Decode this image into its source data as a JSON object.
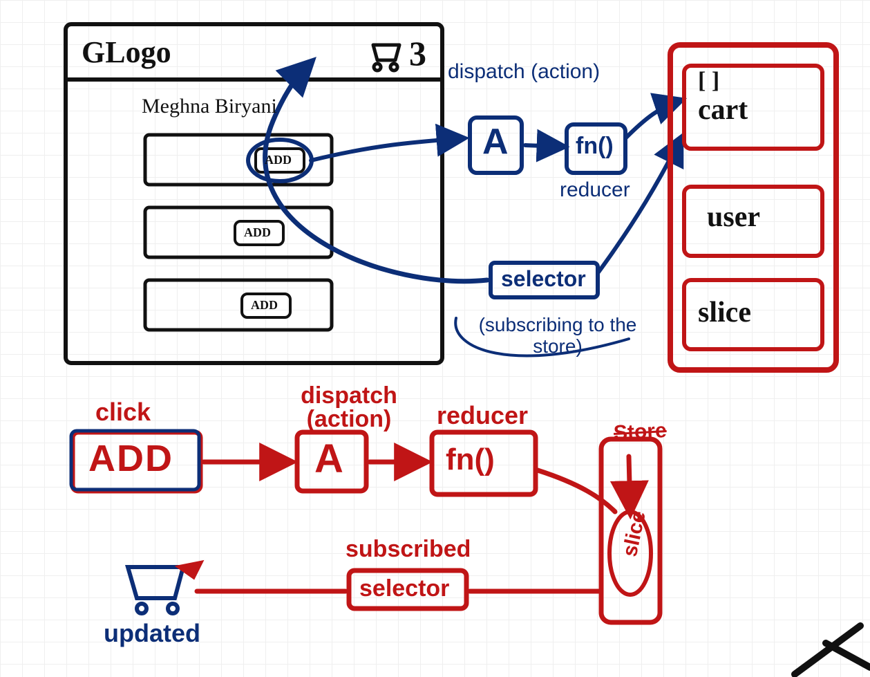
{
  "app": {
    "logo_text": "GLogo",
    "cart_count": "3",
    "product_title": "Meghna Biryani",
    "button_label": "ADD"
  },
  "dataflow": {
    "dispatch_label": "dispatch (action)",
    "action_symbol": "A",
    "reducer_symbol": "fn()",
    "reducer_label": "reducer",
    "selector_label": "selector",
    "subscribe_note": "(subscribing to the store)"
  },
  "store": {
    "slice_cart_items": "[ ]",
    "slice_cart_label": "cart",
    "slice_user_label": "user",
    "slice_slice_label": "slice"
  },
  "recap": {
    "click_label": "click",
    "add_text": "ADD",
    "dispatch_label": "dispatch (action)",
    "action_symbol": "A",
    "reducer_label": "reducer",
    "reducer_symbol": "fn()",
    "store_label": "Store",
    "slice_label": "slice",
    "subscribed_label": "subscribed",
    "selector_label": "selector",
    "updated_label": "updated"
  }
}
